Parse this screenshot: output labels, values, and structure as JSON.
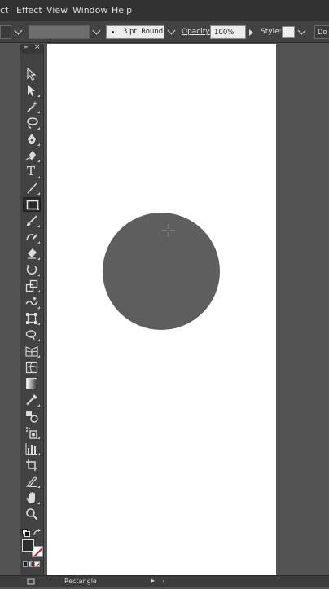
{
  "menu": {
    "items": [
      "ct",
      "Effect",
      "View",
      "Window",
      "Help"
    ]
  },
  "control_bar": {
    "stroke_profile": "3 pt. Round",
    "opacity_label": "Opacity:",
    "opacity_value": "100%",
    "style_label": "Style:",
    "doc_button": "Do"
  },
  "toolbar": {
    "collapse_glyph": "»",
    "close_glyph": "×",
    "tools": [
      {
        "name": "selection-tool-icon"
      },
      {
        "name": "direct-selection-tool-icon"
      },
      {
        "name": "magic-wand-tool-icon"
      },
      {
        "name": "lasso-tool-icon"
      },
      {
        "name": "pen-tool-icon"
      },
      {
        "name": "curvature-tool-icon"
      },
      {
        "name": "type-tool-icon",
        "glyph": "T"
      },
      {
        "name": "line-segment-tool-icon"
      },
      {
        "name": "rectangle-tool-icon",
        "active": true
      },
      {
        "name": "paintbrush-tool-icon"
      },
      {
        "name": "shaper-tool-icon"
      },
      {
        "name": "eraser-tool-icon"
      },
      {
        "name": "rotate-tool-icon"
      },
      {
        "name": "scale-tool-icon"
      },
      {
        "name": "warp-tool-icon"
      },
      {
        "name": "free-transform-tool-icon"
      },
      {
        "name": "shape-builder-tool-icon"
      },
      {
        "name": "perspective-grid-tool-icon"
      },
      {
        "name": "mesh-tool-icon"
      },
      {
        "name": "gradient-tool-icon"
      },
      {
        "name": "eyedropper-tool-icon"
      },
      {
        "name": "blend-tool-icon"
      },
      {
        "name": "symbol-sprayer-tool-icon"
      },
      {
        "name": "column-graph-tool-icon"
      },
      {
        "name": "artboard-tool-icon"
      },
      {
        "name": "slice-tool-icon"
      },
      {
        "name": "hand-tool-icon"
      },
      {
        "name": "zoom-tool-icon"
      }
    ]
  },
  "canvas": {
    "artboard_color": "#ffffff",
    "shape_color": "#5e5e5e"
  },
  "status_bar": {
    "tool_name": "Rectangle"
  }
}
